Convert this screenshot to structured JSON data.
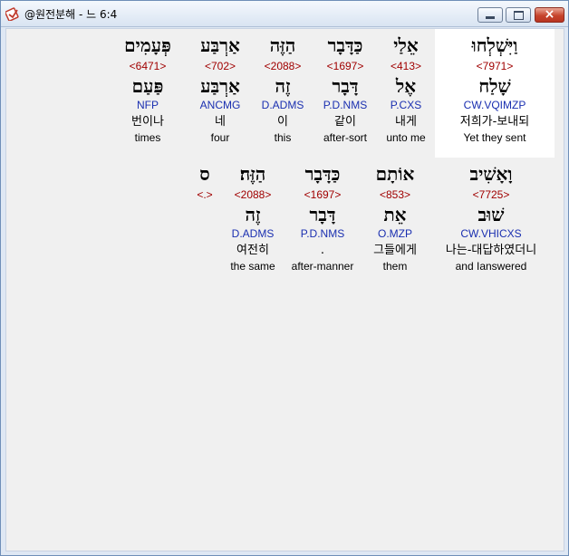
{
  "window": {
    "title": "@원전분해 - 느 6:4",
    "icon": "bible-app-icon",
    "buttons": {
      "minimize": "minimize-icon",
      "maximize": "maximize-icon",
      "close": "×"
    }
  },
  "rows": [
    {
      "words": [
        {
          "heb": "פְּעָמִים",
          "strong": "<6471>",
          "lemma": "פַּעַם",
          "morph": "NFP",
          "kor": "번이나",
          "eng": "times"
        },
        {
          "heb": "אַרְבַּע",
          "strong": "<702>",
          "lemma": "אַרְבַּע",
          "morph": "ANCMG",
          "kor": "네",
          "eng": "four"
        },
        {
          "heb": "הַזֶּה",
          "strong": "<2088>",
          "lemma": "זֶה",
          "morph": "D.ADMS",
          "kor": "이",
          "eng": "this"
        },
        {
          "heb": "כַּדָּבָר",
          "strong": "<1697>",
          "lemma": "דָּבָר",
          "morph": "P.D.NMS",
          "kor": "같이",
          "eng": "after-sort"
        },
        {
          "heb": "אֵלַי",
          "strong": "<413>",
          "lemma": "אֶל",
          "morph": "P.CXS",
          "kor": "내게",
          "eng": "unto me"
        },
        {
          "heb": "וַיִּשְׁלְחוּ",
          "strong": "<7971>",
          "lemma": "שָׁלַח",
          "morph": "CW.VQIMZP",
          "kor": "저희가-보내되",
          "eng": "Yet they sent",
          "highlight": true
        }
      ]
    },
    {
      "words": [
        {
          "heb": "ס",
          "strong": "<.>",
          "lemma": "",
          "morph": "",
          "kor": "",
          "eng": ""
        },
        {
          "heb": "הַזֶּה׃",
          "strong": "<2088>",
          "lemma": "זֶה",
          "morph": "D.ADMS",
          "kor": "여전히",
          "eng": "the same"
        },
        {
          "heb": "כַּדָּבָר",
          "strong": "<1697>",
          "lemma": "דָּבָר",
          "morph": "P.D.NMS",
          "kor": ".",
          "eng": "after-manner"
        },
        {
          "heb": "אוֹתָם",
          "strong": "<853>",
          "lemma": "אֵת",
          "morph": "O.MZP",
          "kor": "그들에게",
          "eng": "them"
        },
        {
          "heb": "וָאָשִׁיב",
          "strong": "<7725>",
          "lemma": "שׁוּב",
          "morph": "CW.VHICXS",
          "kor": "나는-대답하였더니",
          "eng": "and Ianswered"
        }
      ]
    }
  ]
}
